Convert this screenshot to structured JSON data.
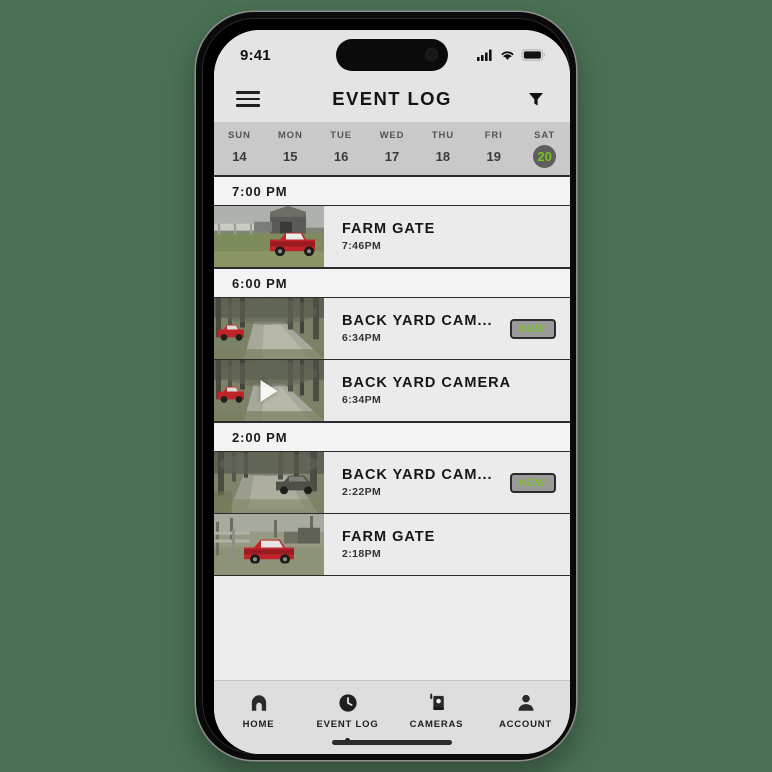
{
  "background_color": "#4a7154",
  "statusbar": {
    "time": "9:41",
    "icons": [
      "cellular-signal-icon",
      "wifi-icon",
      "battery-icon"
    ]
  },
  "header": {
    "menu_icon": "hamburger-menu-icon",
    "title": "EVENT LOG",
    "filter_icon": "filter-funnel-icon"
  },
  "date_strip": {
    "days": [
      {
        "dow": "SUN",
        "num": "14",
        "selected": false
      },
      {
        "dow": "MON",
        "num": "15",
        "selected": false
      },
      {
        "dow": "TUE",
        "num": "16",
        "selected": false
      },
      {
        "dow": "WED",
        "num": "17",
        "selected": false
      },
      {
        "dow": "THU",
        "num": "18",
        "selected": false
      },
      {
        "dow": "FRI",
        "num": "19",
        "selected": false
      },
      {
        "dow": "SAT",
        "num": "20",
        "selected": true
      }
    ],
    "selected_circle_color": "#5e5e5e",
    "selected_text_color": "#7ac420"
  },
  "event_log": {
    "groups": [
      {
        "time_header": "7:00 PM",
        "events": [
          {
            "camera": "FARM GATE",
            "time": "7:46PM",
            "badge": null,
            "has_play_button": false,
            "thumbnail": "red-pickup-truck-by-barn"
          }
        ]
      },
      {
        "time_header": "6:00 PM",
        "events": [
          {
            "camera": "BACK YARD CAM...",
            "time": "6:34PM",
            "badge": "NEW",
            "has_play_button": false,
            "thumbnail": "red-vehicle-on-wooded-trail"
          },
          {
            "camera": "BACK YARD CAMERA",
            "time": "6:34PM",
            "badge": null,
            "has_play_button": true,
            "thumbnail": "red-vehicle-on-wooded-trail-video"
          }
        ]
      },
      {
        "time_header": "2:00 PM",
        "events": [
          {
            "camera": "BACK YARD CAM...",
            "time": "2:22PM",
            "badge": "NEW",
            "has_play_button": false,
            "thumbnail": "dark-suv-on-wooded-trail"
          },
          {
            "camera": "FARM GATE",
            "time": "2:18PM",
            "badge": null,
            "has_play_button": false,
            "thumbnail": "red-pickup-truck-at-gate"
          }
        ]
      }
    ],
    "badge_text_color": "#7ac420",
    "badge_bg_color": "#9a9a9a"
  },
  "tabbar": {
    "tabs": [
      {
        "label": "HOME",
        "icon": "home-icon",
        "active": false
      },
      {
        "label": "EVENT LOG",
        "icon": "clock-icon",
        "active": true
      },
      {
        "label": "CAMERAS",
        "icon": "trail-camera-icon",
        "active": false
      },
      {
        "label": "ACCOUNT",
        "icon": "person-icon",
        "active": false
      }
    ]
  }
}
